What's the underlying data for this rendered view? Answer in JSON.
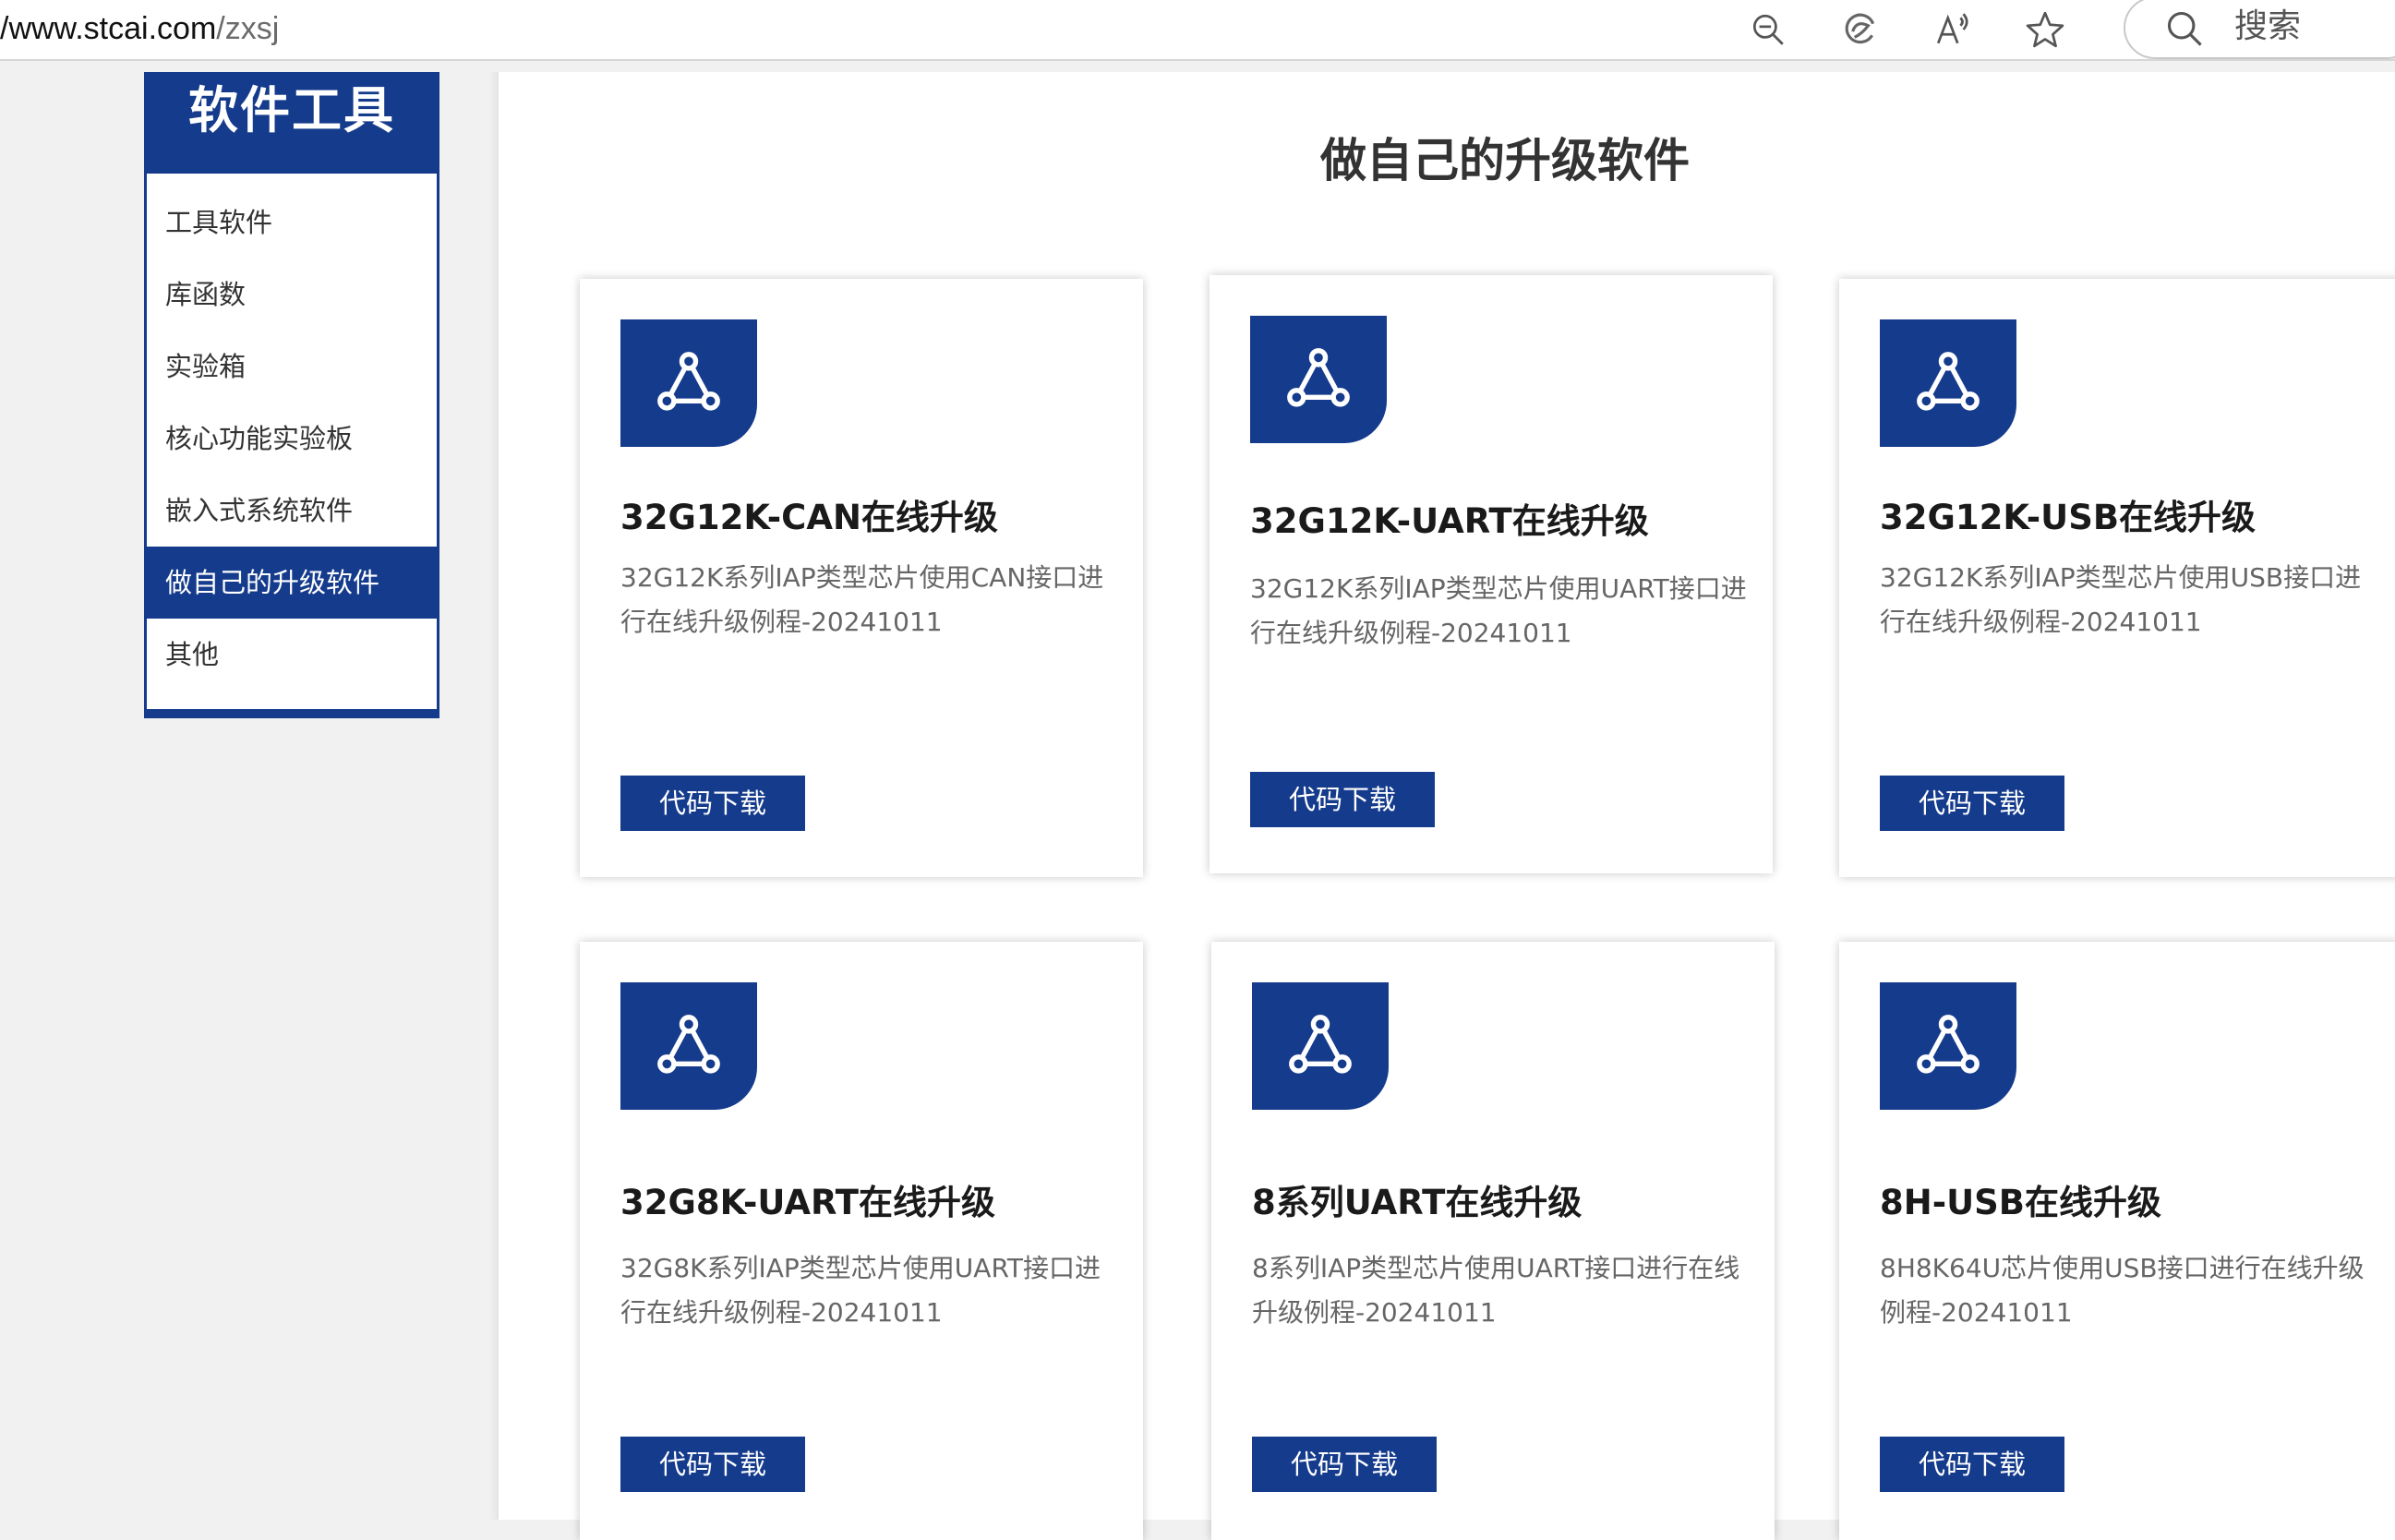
{
  "browser": {
    "url_host": "/www.stcai.com",
    "url_path": "/zxsj",
    "icons": [
      "zoom-out-icon",
      "edge-copilot-icon",
      "read-aloud-icon",
      "favorite-star-icon"
    ],
    "search_label": "搜索"
  },
  "sidebar": {
    "title": "软件工具",
    "items": [
      {
        "label": "工具软件"
      },
      {
        "label": "库函数"
      },
      {
        "label": "实验箱"
      },
      {
        "label": "核心功能实验板"
      },
      {
        "label": "嵌入式系统软件"
      },
      {
        "label": "做自己的升级软件",
        "active": true
      },
      {
        "label": "其他"
      }
    ]
  },
  "main": {
    "title": "做自己的升级软件",
    "accent_color": "#153b8c",
    "cards": [
      {
        "title": "32G12K-CAN在线升级",
        "desc": "32G12K系列IAP类型芯片使用CAN接口进行在线升级例程-20241011",
        "button": "代码下载",
        "icon": "network-nodes-icon"
      },
      {
        "title": "32G12K-UART在线升级",
        "desc": "32G12K系列IAP类型芯片使用UART接口进行在线升级例程-20241011",
        "button": "代码下载",
        "icon": "network-nodes-icon"
      },
      {
        "title": "32G12K-USB在线升级",
        "desc": "32G12K系列IAP类型芯片使用USB接口进行在线升级例程-20241011",
        "button": "代码下载",
        "icon": "network-nodes-icon"
      },
      {
        "title": "32G8K-UART在线升级",
        "desc": "32G8K系列IAP类型芯片使用UART接口进行在线升级例程-20241011",
        "button": "代码下载",
        "icon": "network-nodes-icon"
      },
      {
        "title": "8系列UART在线升级",
        "desc": "8系列IAP类型芯片使用UART接口进行在线升级例程-20241011",
        "button": "代码下载",
        "icon": "network-nodes-icon"
      },
      {
        "title": "8H-USB在线升级",
        "desc": "8H8K64U芯片使用USB接口进行在线升级例程-20241011",
        "button": "代码下载",
        "icon": "network-nodes-icon"
      }
    ]
  }
}
